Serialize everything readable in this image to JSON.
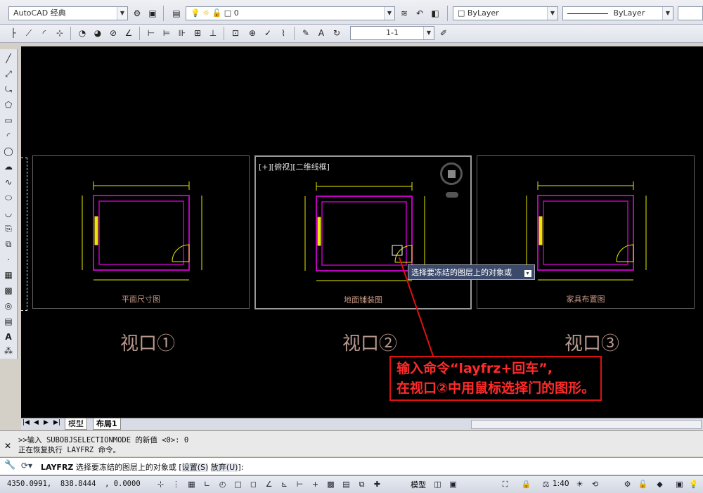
{
  "toolbar": {
    "workspace": "AutoCAD 经典",
    "layer_value": "0",
    "color_value": "ByLayer",
    "linetype_value": "ByLayer",
    "dimstyle_value": "1-1"
  },
  "viewports": [
    {
      "title": "平面尺寸图",
      "label": "视口①"
    },
    {
      "title": "地面铺装图",
      "label": "视口②",
      "header": "[+][俯视][二维线框]"
    },
    {
      "title": "家具布置图",
      "label": "视口③"
    }
  ],
  "tooltip": "选择要冻结的图层上的对象或",
  "annotation": {
    "line1": "输入命令“layfrz+回车”,",
    "line2": "在视口②中用鼠标选择门的图形。"
  },
  "tabs": {
    "model": "模型",
    "layout1": "布局1"
  },
  "command": {
    "history1": ">>输入 SUBOBJSELECTIONMODE 的新值 <0>: 0",
    "history2": "正在恢复执行 LAYFRZ 命令。",
    "prompt_cmd": "LAYFRZ",
    "prompt_text": "选择要冻结的图层上的对象或 [",
    "opt_settings": "设置(S)",
    "opt_undo": "放弃(U)",
    "prompt_end": "]:"
  },
  "status": {
    "coords": "4350.0991,  838.8444  , 0.0000",
    "model_label": "模型",
    "scale": "1:40"
  },
  "colors": {
    "accent_red": "#e01010",
    "frame_magenta": "#c000c0",
    "dim_yellow": "#e8e800"
  }
}
